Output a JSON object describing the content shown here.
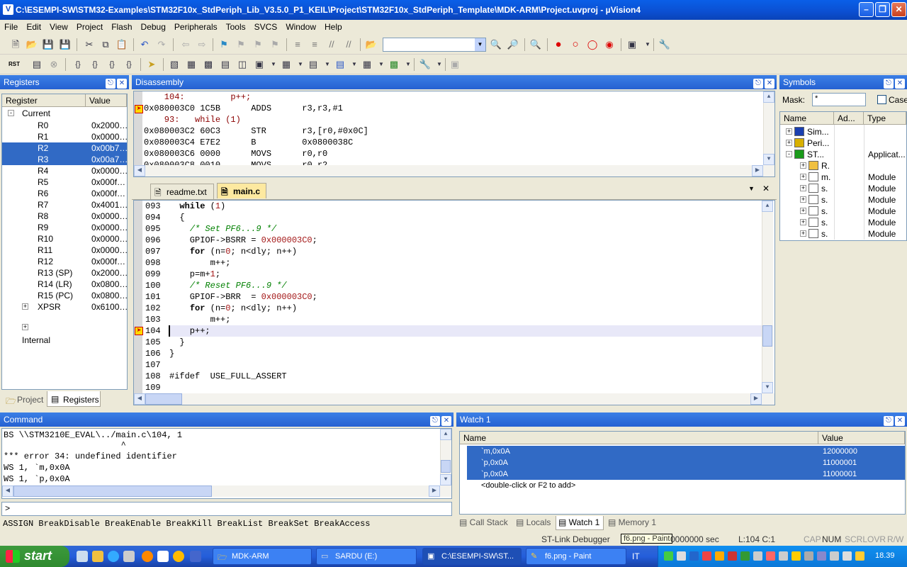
{
  "window": {
    "title": "C:\\ESEMPI-SW\\STM32-Examples\\STM32F10x_StdPeriph_Lib_V3.5.0_P1_KEIL\\Project\\STM32F10x_StdPeriph_Template\\MDK-ARM\\Project.uvproj - µVision4"
  },
  "menu": [
    "File",
    "Edit",
    "View",
    "Project",
    "Flash",
    "Debug",
    "Peripherals",
    "Tools",
    "SVCS",
    "Window",
    "Help"
  ],
  "toolbar2": {
    "rst_label": "RST"
  },
  "registers": {
    "title": "Registers",
    "col_register": "Register",
    "col_value": "Value",
    "group_current": "Current",
    "group_internal": "Internal",
    "rows": [
      {
        "name": "R0",
        "value": "0x2000…"
      },
      {
        "name": "R1",
        "value": "0x0000…"
      },
      {
        "name": "R2",
        "value": "0x00b7…"
      },
      {
        "name": "R3",
        "value": "0x00a7…"
      },
      {
        "name": "R4",
        "value": "0x0000…"
      },
      {
        "name": "R5",
        "value": "0x000f…"
      },
      {
        "name": "R6",
        "value": "0x000f…"
      },
      {
        "name": "R7",
        "value": "0x4001…"
      },
      {
        "name": "R8",
        "value": "0x0000…"
      },
      {
        "name": "R9",
        "value": "0x0000…"
      },
      {
        "name": "R10",
        "value": "0x0000…"
      },
      {
        "name": "R11",
        "value": "0x0000…"
      },
      {
        "name": "R12",
        "value": "0x000f…"
      },
      {
        "name": "R13 (SP)",
        "value": "0x2000…"
      },
      {
        "name": "R14 (LR)",
        "value": "0x0800…"
      },
      {
        "name": "R15 (PC)",
        "value": "0x0800…"
      },
      {
        "name": "XPSR",
        "value": "0x6100…"
      }
    ],
    "tab_project": "Project",
    "tab_registers": "Registers"
  },
  "disassembly": {
    "title": "Disassembly",
    "lines": [
      "    104:         p++;",
      "0x080003C0 1C5B      ADDS      r3,r3,#1",
      "    93:   while (1)",
      "0x080003C2 60C3      STR       r3,[r0,#0x0C]",
      "0x080003C4 E7E2      B         0x0800038C",
      "0x080003C6 0000      MOVS      r0,r0",
      "0x080003C8 0010      MOVS      r0,r2"
    ]
  },
  "editor": {
    "tabs": [
      "readme.txt",
      "main.c"
    ],
    "lines": [
      {
        "n": "093",
        "t": "  while (1)"
      },
      {
        "n": "094",
        "t": "  {"
      },
      {
        "n": "095",
        "t": "    /* Set PF6...9 */"
      },
      {
        "n": "096",
        "t": "    GPIOF->BSRR = 0x000003C0;"
      },
      {
        "n": "097",
        "t": "    for (n=0; n<dly; n++)"
      },
      {
        "n": "098",
        "t": "        m++;"
      },
      {
        "n": "099",
        "t": "    p=m+1;"
      },
      {
        "n": "100",
        "t": "    /* Reset PF6...9 */"
      },
      {
        "n": "101",
        "t": "    GPIOF->BRR  = 0x000003C0;"
      },
      {
        "n": "102",
        "t": "    for (n=0; n<dly; n++)"
      },
      {
        "n": "103",
        "t": "        m++;"
      },
      {
        "n": "104",
        "t": "    p++;"
      },
      {
        "n": "105",
        "t": "  }"
      },
      {
        "n": "106",
        "t": "}"
      },
      {
        "n": "107",
        "t": ""
      },
      {
        "n": "108",
        "t": "#ifdef  USE_FULL_ASSERT"
      },
      {
        "n": "109",
        "t": ""
      }
    ]
  },
  "symbols": {
    "title": "Symbols",
    "mask_label": "Mask:",
    "mask_value": "*",
    "case_label": "Case",
    "col_name": "Name",
    "col_addr": "Ad...",
    "col_type": "Type",
    "rows": [
      {
        "name": "Sim...",
        "type": ""
      },
      {
        "name": "Peri...",
        "type": ""
      },
      {
        "name": "ST...",
        "type": "Applicat..."
      },
      {
        "name": "R.",
        "type": ""
      },
      {
        "name": "m.",
        "type": "Module"
      },
      {
        "name": "s.",
        "type": "Module"
      },
      {
        "name": "s.",
        "type": "Module"
      },
      {
        "name": "s.",
        "type": "Module"
      },
      {
        "name": "s.",
        "type": "Module"
      },
      {
        "name": "s.",
        "type": "Module"
      }
    ]
  },
  "command": {
    "title": "Command",
    "lines": [
      "BS \\\\STM3210E_EVAL\\../main.c\\104, 1",
      "                       ^",
      "*** error 34: undefined identifier",
      "WS 1, `m,0x0A",
      "WS 1, `p,0x0A"
    ],
    "prompt": ">",
    "hint": "ASSIGN BreakDisable BreakEnable BreakKill BreakList BreakSet BreakAccess"
  },
  "watch": {
    "title": "Watch 1",
    "col_name": "Name",
    "col_value": "Value",
    "rows": [
      {
        "name": "`m,0x0A",
        "value": "12000000"
      },
      {
        "name": "`p,0x0A",
        "value": "11000001"
      },
      {
        "name": "`p,0x0A",
        "value": "11000001"
      },
      {
        "name": "<double-click or F2 to add>",
        "value": ""
      }
    ],
    "tabs": [
      "Call Stack",
      "Locals",
      "Watch 1",
      "Memory 1"
    ]
  },
  "status": {
    "debugger": "ST-Link Debugger",
    "tooltip": "f6.png - Paint",
    "time": "0000000 sec",
    "pos": "L:104 C:1",
    "cap": "CAP",
    "num": "NUM",
    "scrl": "SCRL",
    "ovr": "OVR",
    "rw": "R/W"
  },
  "taskbar": {
    "start": "start",
    "tasks": [
      "MDK-ARM",
      "SARDU (E:)",
      "C:\\ESEMPI-SW\\ST...",
      "f6.png - Paint"
    ],
    "lang": "IT",
    "clock": "18.39"
  }
}
